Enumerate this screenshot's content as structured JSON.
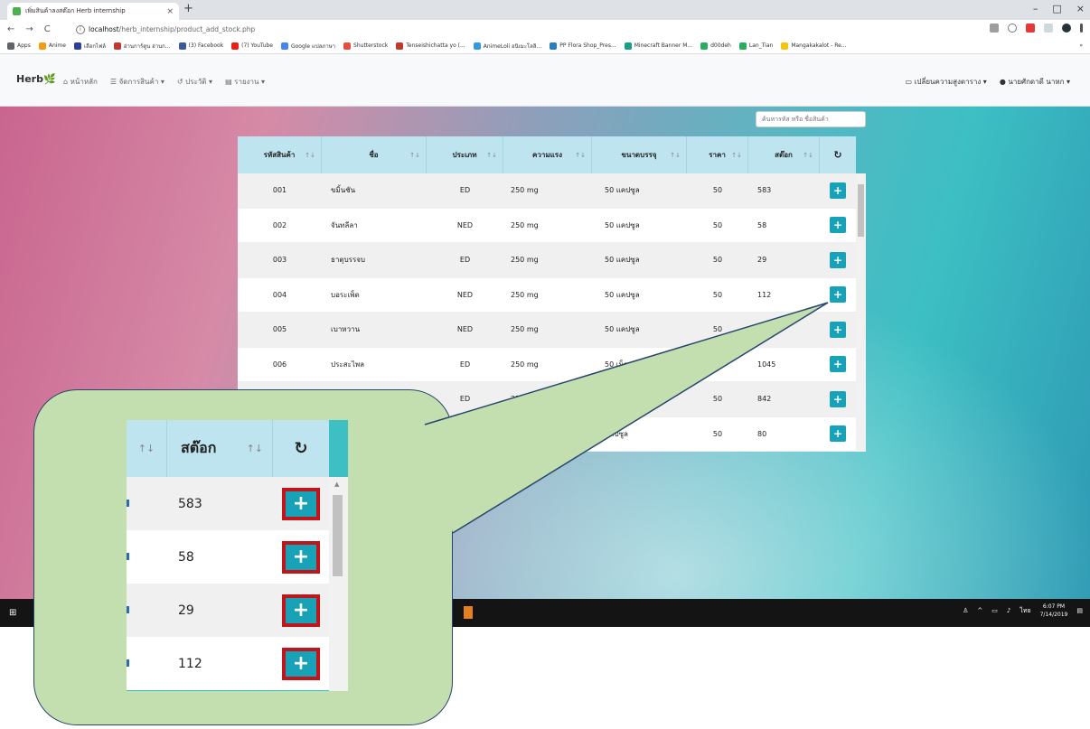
{
  "browser": {
    "tab_title": "เพิ่มสินค้าลงสต๊อก Herb internship",
    "tab_close": "×",
    "new_tab": "+",
    "window_controls": [
      "–",
      "□",
      "×"
    ],
    "nav_buttons": [
      "←",
      "→",
      "C"
    ],
    "url_host": "localhost",
    "url_path": "/herb_internship/product_add_stock.php",
    "bookmarks": [
      {
        "label": "Apps",
        "color": "#5f6368"
      },
      {
        "label": "Anime",
        "color": "#f39c12"
      },
      {
        "label": "เลือกไฟล์",
        "color": "#2c3e98"
      },
      {
        "label": "อ่านการ์ตูน อ่านก...",
        "color": "#c0392b"
      },
      {
        "label": "(3) Facebook",
        "color": "#3b5998"
      },
      {
        "label": "(7) YouTube",
        "color": "#e62117"
      },
      {
        "label": "Google แปลภาษา",
        "color": "#4285f4"
      },
      {
        "label": "Shutterstock",
        "color": "#e74c3c"
      },
      {
        "label": "Tenseishichatta yo (...",
        "color": "#c0392b"
      },
      {
        "label": "AnimeLoli อนิเมะโลลิ...",
        "color": "#3498db"
      },
      {
        "label": "PP Flora Shop_Pres...",
        "color": "#2980b9"
      },
      {
        "label": "Minecraft Banner M...",
        "color": "#16a085"
      },
      {
        "label": "d00deh",
        "color": "#27ae60"
      },
      {
        "label": "Lan_Tian",
        "color": "#27ae60"
      },
      {
        "label": "Mangakakalot - Re...",
        "color": "#f1c40f"
      }
    ],
    "bookmarks_more": "»"
  },
  "appnav": {
    "brand": "Herb",
    "brand_leaf": "🌿",
    "menu": [
      {
        "icon": "⌂",
        "label": "หน้าหลัก"
      },
      {
        "icon": "☰",
        "label": "จัดการสินค้า ▾"
      },
      {
        "icon": "↺",
        "label": "ประวัติ ▾"
      },
      {
        "icon": "▤",
        "label": "รายงาน ▾"
      }
    ],
    "right_menu": [
      {
        "icon": "▭",
        "label": "เปลี่ยนความสูงตาราง ▾"
      },
      {
        "icon": "●",
        "label": "นายศักดาดี นาหก ▾"
      }
    ]
  },
  "search": {
    "placeholder": "ค้นหารหัส หรือ ชื่อสินค้า"
  },
  "table": {
    "headers": [
      "รหัสสินค้า",
      "ชื่อ",
      "ประเภท",
      "ความแรง",
      "ขนาดบรรจุ",
      "ราคา",
      "สต๊อก"
    ],
    "sort_icon": "↑↓",
    "refresh_icon": "↻",
    "add_label": "+",
    "rows": [
      [
        "001",
        "ขมิ้นชัน",
        "ED",
        "250 mg",
        "50 แคปซูล",
        "50",
        "583"
      ],
      [
        "002",
        "จันทลีลา",
        "NED",
        "250 mg",
        "50 แคปซูล",
        "50",
        "58"
      ],
      [
        "003",
        "ธาตุบรรจบ",
        "ED",
        "250 mg",
        "50 แคปซูล",
        "50",
        "29"
      ],
      [
        "004",
        "บอระเพ็ด",
        "NED",
        "250 mg",
        "50 แคปซูล",
        "50",
        "112"
      ],
      [
        "005",
        "เบาหวาน",
        "NED",
        "250 mg",
        "50 แคปซูล",
        "50",
        ""
      ],
      [
        "006",
        "ประสะไพล",
        "ED",
        "250 mg",
        "50 เม็ด",
        "",
        "1045"
      ],
      [
        "",
        "",
        "ED",
        "250 mg",
        "",
        "50",
        "842"
      ],
      [
        "",
        "",
        "ED",
        "",
        "แคปซูล",
        "50",
        "80"
      ]
    ]
  },
  "taskbar": {
    "start_icon": "⊞",
    "tray_text": "ไทย",
    "time": "6:07 PM",
    "date": "7/14/2019"
  },
  "zoom": {
    "header_sort": "↑↓",
    "header_label": "สต๊อก",
    "header_refresh": "↻",
    "values": [
      "583",
      "58",
      "29",
      "112"
    ],
    "add_label": "+"
  }
}
